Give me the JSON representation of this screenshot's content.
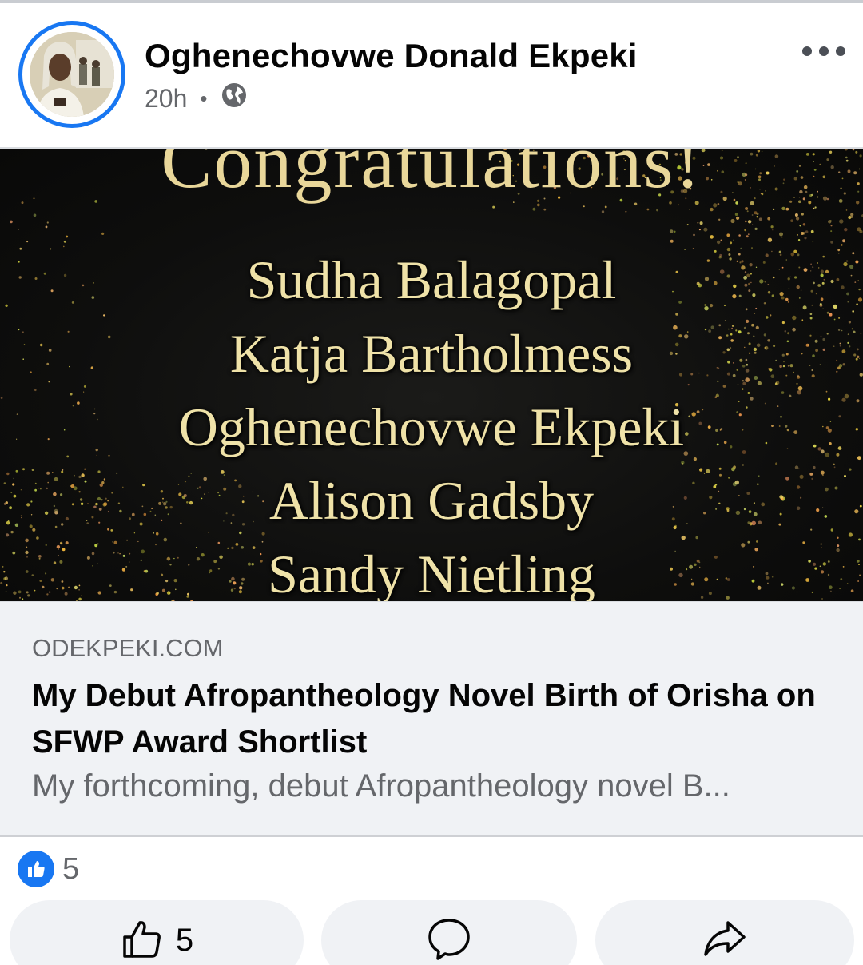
{
  "post": {
    "author": "Oghenechovwe Donald Ekpeki",
    "time": "20h",
    "separator": "•",
    "audience_icon": "globe-icon",
    "more_icon": "more-horizontal-icon"
  },
  "image": {
    "headline_text": "Congratulations!",
    "names": [
      "Sudha Balagopal",
      "Katja Bartholmess",
      "Oghenechovwe Ekpeki",
      "Alison Gadsby",
      "Sandy Nietling"
    ]
  },
  "link": {
    "domain": "ODEKPEKI.COM",
    "title": "My Debut Afropantheology Novel Birth of Orisha on SFWP Award Shortlist",
    "description": "My forthcoming, debut Afropantheology novel B..."
  },
  "reactions": {
    "icon": "like-reaction-icon",
    "count": "5"
  },
  "actions": {
    "like_icon": "thumbs-up-icon",
    "like_count": "5",
    "comment_icon": "comment-icon",
    "share_icon": "share-icon"
  },
  "colors": {
    "brand_blue": "#1877f2",
    "gold_text": "#efe2a8",
    "banner_bg": "#0e0e0d",
    "card_bg": "#f0f2f5",
    "secondary_text": "#65676b"
  }
}
